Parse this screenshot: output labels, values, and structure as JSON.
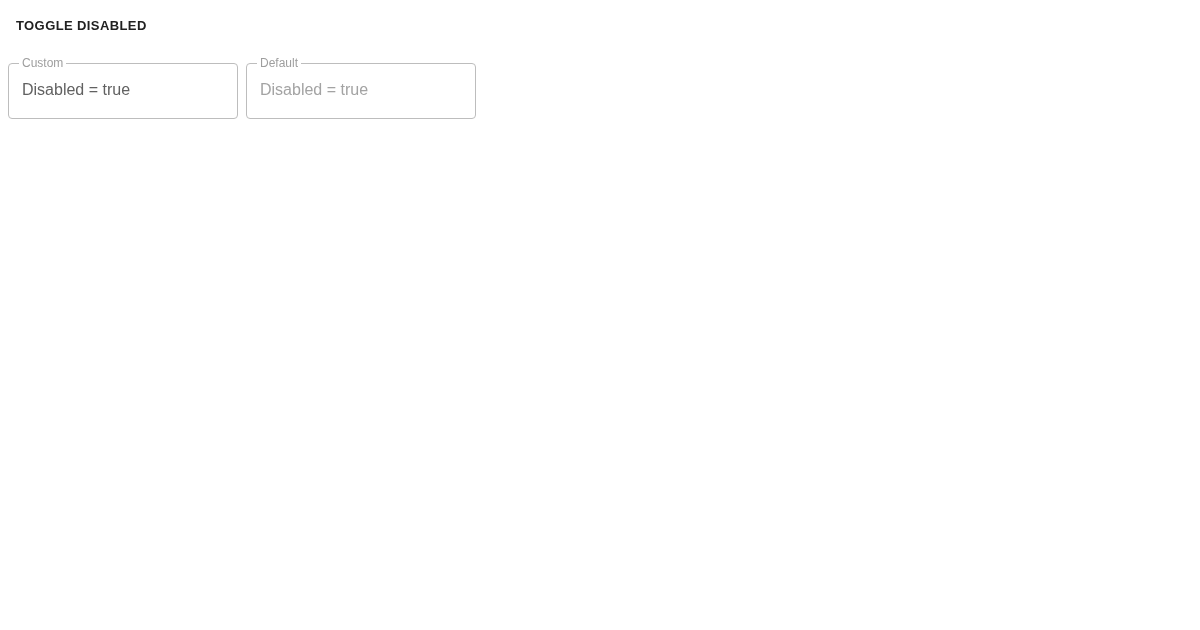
{
  "toggle_button": {
    "label": "TOGGLE DISABLED"
  },
  "fields": [
    {
      "kind": "custom",
      "label": "Custom",
      "value": "Disabled = true",
      "disabled": true
    },
    {
      "kind": "default",
      "label": "Default",
      "value": "Disabled = true",
      "disabled": true
    }
  ]
}
